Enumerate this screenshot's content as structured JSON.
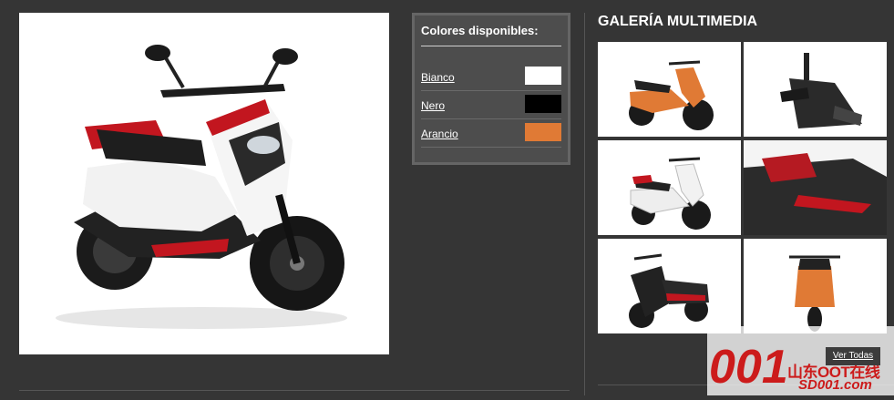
{
  "colors_panel": {
    "title": "Colores disponibles:",
    "options": [
      {
        "name": "Bianco",
        "hex": "#ffffff"
      },
      {
        "name": "Nero",
        "hex": "#000000"
      },
      {
        "name": "Arancio",
        "hex": "#e07a35"
      }
    ]
  },
  "gallery": {
    "title": "GALERÍA MULTIMEDIA",
    "see_all_label": "Ver Todas",
    "thumbnails": [
      {
        "subject": "orange-scooter-side"
      },
      {
        "subject": "handlebar-closeup"
      },
      {
        "subject": "white-scooter"
      },
      {
        "subject": "seat-closeup"
      },
      {
        "subject": "black-scooter-front"
      },
      {
        "subject": "scooter-rear"
      }
    ]
  },
  "main_image": {
    "subject": "white-red-scooter"
  },
  "watermark": {
    "logo_text": "001",
    "chinese_text": "山东OOT在线",
    "site_text": "SD001.com"
  }
}
